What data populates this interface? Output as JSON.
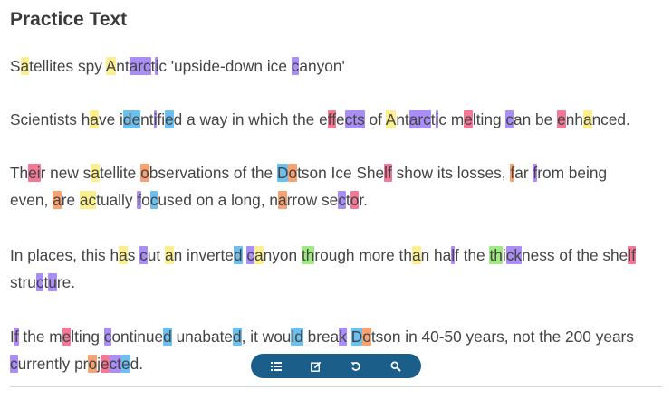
{
  "title": "Practice Text",
  "colors": {
    "toolbar_bg": "#1c5e8a",
    "yellow": "#fbef8f",
    "orange": "#f8a274",
    "purple": "#a98ef5",
    "blue": "#6dc0ee",
    "pink": "#f37896",
    "green": "#9ee982",
    "violet": "#b389f4"
  },
  "paragraphs": [
    {
      "lines": [
        [
          {
            "t": "S"
          },
          {
            "t": "a",
            "c": "yellow"
          },
          {
            "t": "tellites spy "
          },
          {
            "t": "A",
            "c": "yellow"
          },
          {
            "t": "nt"
          },
          {
            "t": "arc",
            "c": "purple"
          },
          {
            "t": "t"
          },
          {
            "t": "i",
            "c": "purple"
          },
          {
            "t": "c 'upside-down ice "
          },
          {
            "t": "c",
            "c": "purple"
          },
          {
            "t": "anyon'"
          }
        ]
      ]
    },
    {
      "lines": [
        [
          {
            "t": "Scientists h"
          },
          {
            "t": "a",
            "c": "yellow"
          },
          {
            "t": "ve i"
          },
          {
            "t": "de",
            "c": "blue"
          },
          {
            "t": "nt"
          },
          {
            "t": "i",
            "c": "violet"
          },
          {
            "t": "fi"
          },
          {
            "t": "e",
            "c": "blue"
          },
          {
            "t": "d a way in which the e"
          },
          {
            "t": "ff",
            "c": "pink"
          },
          {
            "t": "e"
          },
          {
            "t": "cts",
            "c": "purple"
          },
          {
            "t": " of "
          },
          {
            "t": "A",
            "c": "yellow"
          },
          {
            "t": "nt"
          },
          {
            "t": "arc",
            "c": "purple"
          },
          {
            "t": "t"
          },
          {
            "t": "i",
            "c": "purple"
          },
          {
            "t": "c m"
          },
          {
            "t": "e",
            "c": "pink"
          },
          {
            "t": "lting "
          },
          {
            "t": "c",
            "c": "purple"
          },
          {
            "t": "an be "
          },
          {
            "t": "e",
            "c": "pink"
          },
          {
            "t": "nh"
          },
          {
            "t": "a",
            "c": "yellow"
          },
          {
            "t": "nced."
          }
        ]
      ]
    },
    {
      "lines": [
        [
          {
            "t": "Th"
          },
          {
            "t": "ei",
            "c": "pink"
          },
          {
            "t": "r new s"
          },
          {
            "t": "a",
            "c": "yellow"
          },
          {
            "t": "tellite "
          },
          {
            "t": "o",
            "c": "orange"
          },
          {
            "t": "bservations of the "
          },
          {
            "t": "D",
            "c": "blue"
          },
          {
            "t": "o",
            "c": "orange"
          },
          {
            "t": "tson Ice She"
          },
          {
            "t": "lf",
            "c": "pink"
          },
          {
            "t": " show its losses, "
          },
          {
            "t": "f",
            "c": "orange"
          },
          {
            "t": "ar "
          },
          {
            "t": "f",
            "c": "violet"
          },
          {
            "t": "rom being"
          }
        ],
        [
          {
            "t": "even, "
          },
          {
            "t": "a",
            "c": "orange"
          },
          {
            "t": "re "
          },
          {
            "t": "ac",
            "c": "yellow"
          },
          {
            "t": "tually "
          },
          {
            "t": "f",
            "c": "purple"
          },
          {
            "t": "o"
          },
          {
            "t": "c",
            "c": "blue"
          },
          {
            "t": "used on a long, n"
          },
          {
            "t": "a",
            "c": "orange"
          },
          {
            "t": "rrow se"
          },
          {
            "t": "c",
            "c": "purple"
          },
          {
            "t": "t"
          },
          {
            "t": "o",
            "c": "pink"
          },
          {
            "t": "r."
          }
        ]
      ]
    },
    {
      "lines": [
        [
          {
            "t": "In places, this h"
          },
          {
            "t": "a",
            "c": "yellow"
          },
          {
            "t": "s "
          },
          {
            "t": "c",
            "c": "purple"
          },
          {
            "t": "ut "
          },
          {
            "t": "a",
            "c": "yellow"
          },
          {
            "t": "n inverte"
          },
          {
            "t": "d",
            "c": "blue"
          },
          {
            "t": " "
          },
          {
            "t": "c",
            "c": "purple"
          },
          {
            "t": "a",
            "c": "yellow"
          },
          {
            "t": "nyon "
          },
          {
            "t": "th",
            "c": "green"
          },
          {
            "t": "rough more th"
          },
          {
            "t": "a",
            "c": "yellow"
          },
          {
            "t": "n ha"
          },
          {
            "t": "l",
            "c": "violet"
          },
          {
            "t": "f the "
          },
          {
            "t": "th",
            "c": "green"
          },
          {
            "t": "i"
          },
          {
            "t": "ck",
            "c": "purple"
          },
          {
            "t": "ness of the she"
          },
          {
            "t": "lf",
            "c": "pink"
          }
        ],
        [
          {
            "t": "stru"
          },
          {
            "t": "c",
            "c": "purple"
          },
          {
            "t": "t"
          },
          {
            "t": "u",
            "c": "purple"
          },
          {
            "t": "re."
          }
        ]
      ]
    },
    {
      "lines": [
        [
          {
            "t": "I"
          },
          {
            "t": "f",
            "c": "violet"
          },
          {
            "t": " the m"
          },
          {
            "t": "e",
            "c": "pink"
          },
          {
            "t": "lting "
          },
          {
            "t": "c",
            "c": "purple"
          },
          {
            "t": "ontinue"
          },
          {
            "t": "d",
            "c": "blue"
          },
          {
            "t": " unabate"
          },
          {
            "t": "d",
            "c": "blue"
          },
          {
            "t": ", it wou"
          },
          {
            "t": "ld",
            "c": "blue"
          },
          {
            "t": " brea"
          },
          {
            "t": "k",
            "c": "purple"
          },
          {
            "t": " "
          },
          {
            "t": "D",
            "c": "blue"
          },
          {
            "t": "o",
            "c": "orange"
          },
          {
            "t": "tson in 40-50 years, not the 200 years"
          }
        ],
        [
          {
            "t": "c",
            "c": "purple"
          },
          {
            "t": "urrently pr"
          },
          {
            "t": "o",
            "c": "orange"
          },
          {
            "t": "j"
          },
          {
            "t": "e",
            "c": "pink"
          },
          {
            "t": "ct",
            "c": "purple"
          },
          {
            "t": "e",
            "c": "blue"
          },
          {
            "t": "d."
          }
        ]
      ]
    }
  ],
  "toolbar": {
    "buttons": [
      {
        "name": "list-icon-button",
        "icon": "list-icon"
      },
      {
        "name": "edit-icon-button",
        "icon": "edit-icon"
      },
      {
        "name": "undo-icon-button",
        "icon": "undo-icon"
      },
      {
        "name": "search-icon-button",
        "icon": "search-icon"
      }
    ]
  }
}
